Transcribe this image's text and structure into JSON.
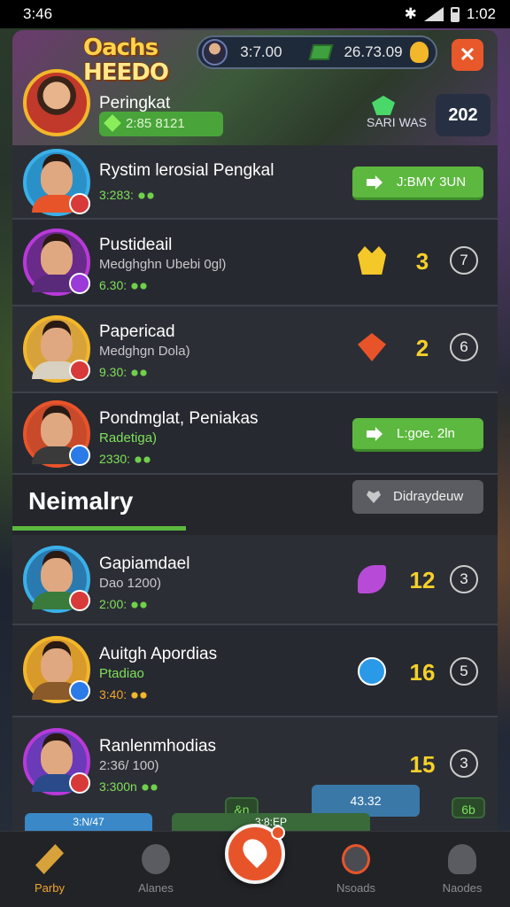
{
  "status_bar": {
    "time": "3:46",
    "right_time": "1:02"
  },
  "header": {
    "logo_line1": "Oachs",
    "logo_line2": "HEEDO",
    "currency1": "3:7.00",
    "currency2": "26.73.09",
    "player_name": "Peringkat",
    "rank_label": "2:85 8121",
    "badge_label": "SARI WAS",
    "score": "202"
  },
  "rows_top": [
    {
      "name": "Rystim lerosial Pengkal",
      "sub": "",
      "stat": "3:283:",
      "button": "J:BMY 3UN",
      "rank": "",
      "pos": ""
    },
    {
      "name": "Pustideail",
      "sub": "Medghghn Ubebi 0gl)",
      "stat": "6.30:",
      "button": "",
      "rank": "3",
      "pos": "7"
    },
    {
      "name": "Papericad",
      "sub": "Medghgn Dola)",
      "stat": "9.30:",
      "button": "",
      "rank": "2",
      "pos": "6"
    },
    {
      "name": "Pondmglat, Peniakas",
      "sub": "Radetiga)",
      "stat": "2330:",
      "button": "L:goe. 2ln",
      "rank": "",
      "pos": ""
    }
  ],
  "section": {
    "title": "Neimalry",
    "button": "Didraydeuw"
  },
  "rows_bottom": [
    {
      "name": "Gapiamdael",
      "sub": "Dao 1200)",
      "stat": "2:00:",
      "rank": "12",
      "pos": "3"
    },
    {
      "name": "Auitgh Apordias",
      "sub": "Ptadiao",
      "stat": "3:40:",
      "rank": "16",
      "pos": "5"
    },
    {
      "name": "Ranlenmhodias",
      "sub": "2:36/ 100)",
      "stat": "3:300n",
      "rank": "15",
      "pos": "3"
    }
  ],
  "strip": {
    "pill1": "&n",
    "pill2": "43.32",
    "pill3": "6b",
    "pill4": "3:N/47",
    "pill5": "3:8:EP"
  },
  "nav": {
    "item1": "Parby",
    "item2": "Alanes",
    "item3": "Nsoads",
    "item4": "Naodes"
  },
  "colors": {
    "accent_green": "#5cb83f",
    "accent_orange": "#e8542a",
    "gold": "#f5d02a"
  }
}
